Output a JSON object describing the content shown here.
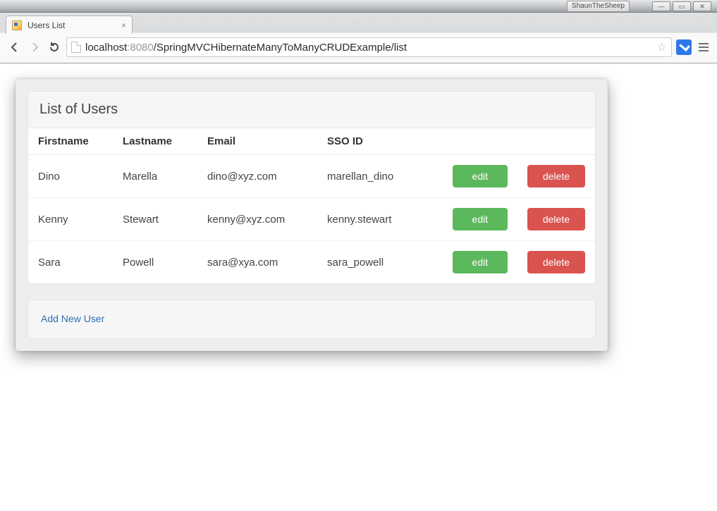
{
  "os": {
    "app_badge": "ShaunTheSheep"
  },
  "browser": {
    "tab_title": "Users List",
    "url_host_prefix": "localhost",
    "url_host_port": ":8080",
    "url_path": "/SpringMVCHibernateManyToManyCRUDExample/list"
  },
  "page": {
    "heading": "List of Users",
    "columns": {
      "firstname": "Firstname",
      "lastname": "Lastname",
      "email": "Email",
      "sso": "SSO ID"
    },
    "buttons": {
      "edit": "edit",
      "delete": "delete"
    },
    "add_link": "Add New User",
    "rows": [
      {
        "firstname": "Dino",
        "lastname": "Marella",
        "email": "dino@xyz.com",
        "sso": "marellan_dino"
      },
      {
        "firstname": "Kenny",
        "lastname": "Stewart",
        "email": "kenny@xyz.com",
        "sso": "kenny.stewart"
      },
      {
        "firstname": "Sara",
        "lastname": "Powell",
        "email": "sara@xya.com",
        "sso": "sara_powell"
      }
    ]
  }
}
